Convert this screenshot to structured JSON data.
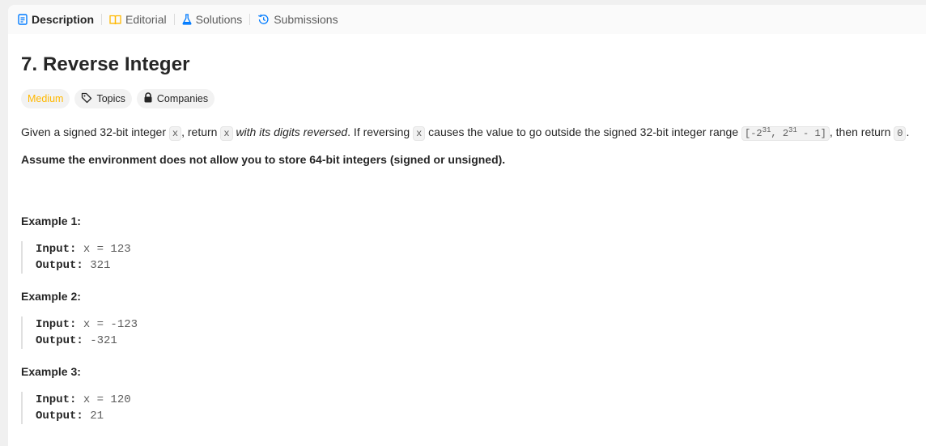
{
  "tabs": [
    {
      "label": "Description",
      "icon": "document-icon",
      "active": true
    },
    {
      "label": "Editorial",
      "icon": "book-icon",
      "active": false
    },
    {
      "label": "Solutions",
      "icon": "flask-icon",
      "active": false
    },
    {
      "label": "Submissions",
      "icon": "history-icon",
      "active": false
    }
  ],
  "problem": {
    "title": "7. Reverse Integer",
    "difficulty": "Medium",
    "topics_label": "Topics",
    "companies_label": "Companies",
    "desc": {
      "p1": "Given a signed 32-bit integer ",
      "code_x": "x",
      "p2": ", return ",
      "p3": " ",
      "em": "with its digits reversed",
      "p4": ". If reversing ",
      "p5": " causes the value to go outside the signed 32-bit integer range ",
      "range_open": "[-2",
      "exp1": "31",
      "range_mid": ", 2",
      "exp2": "31",
      "range_close": " - 1]",
      "p6": ", then return ",
      "zero": "0",
      "p7": "."
    },
    "assume": "Assume the environment does not allow you to store 64-bit integers (signed or unsigned).",
    "examples": [
      {
        "title": "Example 1:",
        "input_label": "Input:",
        "input": "x = 123",
        "output_label": "Output:",
        "output": "321"
      },
      {
        "title": "Example 2:",
        "input_label": "Input:",
        "input": "x = -123",
        "output_label": "Output:",
        "output": "-321"
      },
      {
        "title": "Example 3:",
        "input_label": "Input:",
        "input": "x = 120",
        "output_label": "Output:",
        "output": "21"
      }
    ]
  },
  "colors": {
    "difficulty_medium": "#ffb800",
    "active_tab_icon": "#007bff",
    "editorial_icon": "#ffb800",
    "solutions_icon": "#007bff",
    "submissions_icon": "#007bff"
  }
}
